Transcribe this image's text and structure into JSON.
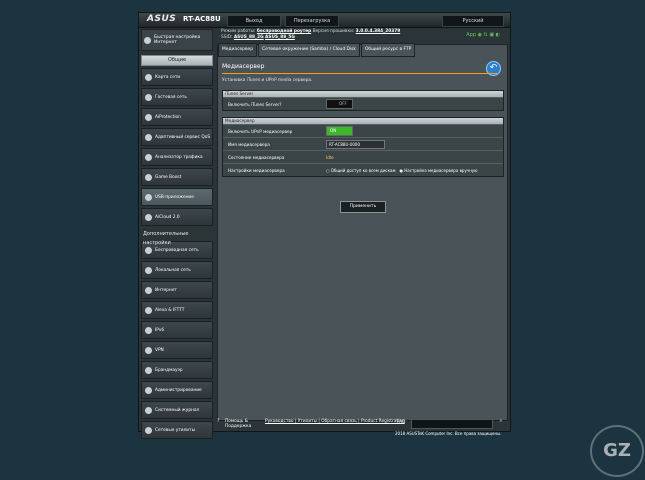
{
  "header": {
    "logo": "ASUS",
    "model": "RT-AC88U",
    "logout": "Выход",
    "reboot": "Перезагрузка",
    "language": "Русский",
    "mode_label": "Режим работы:",
    "mode_value": "беспроводной роутер",
    "firmware_label": "Версия прошивки:",
    "firmware_value": "3.0.0.4.384_20379",
    "ssid_label": "SSID:",
    "ssid_1": "ASUS_88_2G",
    "ssid_2": "ASUS_88_5G",
    "app_label": "App"
  },
  "sidebar": {
    "quick_setup": "Быстрая настройка Интернет",
    "general_header": "Общие",
    "items": [
      "Карта сети",
      "Гостевая сеть",
      "AiProtection",
      "Адаптивный сервис QoS",
      "Анализатор трафика",
      "Game Boost",
      "USB-приложение",
      "AiCloud 2.0"
    ],
    "advanced_header": "Дополнительные настройки",
    "advanced_items": [
      "Беспроводная сеть",
      "Локальная сеть",
      "Интернет",
      "Alexa & IFTTT",
      "IPv6",
      "VPN",
      "Брандмауэр",
      "Администрирование",
      "Системный журнал",
      "Сетевые утилиты"
    ]
  },
  "tabs": [
    "Медиасервер",
    "Сетевое окружение (Samba) / Cloud Disk",
    "Общий ресурс в FTP"
  ],
  "page": {
    "title": "Медиасервер",
    "description": "Установка iTunes и UPnP media сервера.",
    "itunes_header": "iTunes Server",
    "itunes_label": "Включить iTunes Server?",
    "itunes_toggle": "OFF",
    "media_header": "Медиасервер",
    "upnp_label": "Включить UPnP медиасервер",
    "upnp_toggle": "ON",
    "name_label": "Имя медиасервера",
    "name_value": "RT-AC88U-0000",
    "state_label": "Состояние медиасервера",
    "state_value": "Idle",
    "settings_label": "Настройки медиасервера",
    "settings_option_1": "Общий доступ ко всем дискам",
    "settings_option_2": "Настройка медиасервера вручную",
    "apply": "Применить"
  },
  "footer": {
    "help": "Помощь & Поддержка",
    "links": "Руководство | Утилиты | Обратная связь | Product Registration",
    "faq": "FAQ",
    "copyright": "2018 ASUSTeK Computer Inc. Все права защищены."
  }
}
